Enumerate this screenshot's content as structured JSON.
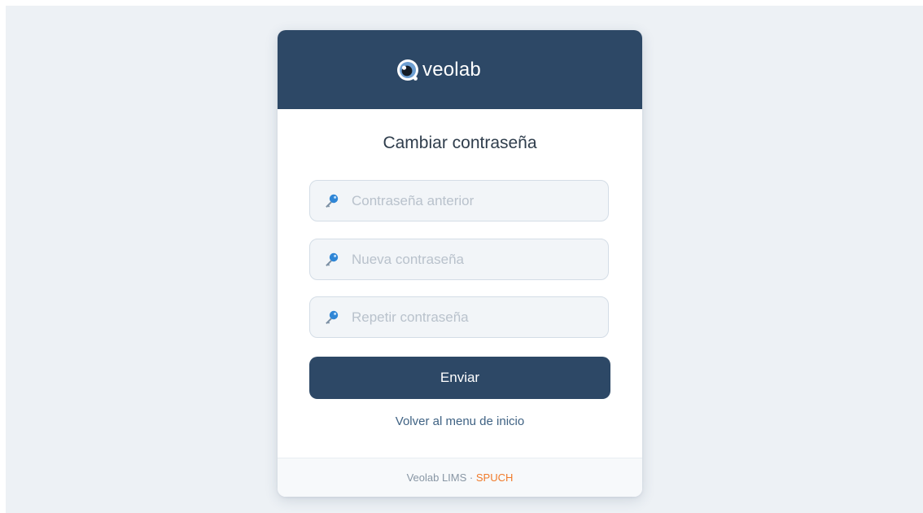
{
  "brand": {
    "name": "veolab",
    "icon": "veolab-logo-icon",
    "header_color": "#2d4866"
  },
  "form": {
    "title": "Cambiar contraseña",
    "fields": [
      {
        "placeholder": "Contraseña anterior",
        "value": "",
        "icon": "key-icon"
      },
      {
        "placeholder": "Nueva contraseña",
        "value": "",
        "icon": "key-icon"
      },
      {
        "placeholder": "Repetir contraseña",
        "value": "",
        "icon": "key-icon"
      }
    ],
    "submit_label": "Enviar",
    "back_link": "Volver al menu de inicio"
  },
  "footer": {
    "product": "Veolab LIMS",
    "separator": "·",
    "org": "SPUCH",
    "org_color": "#f07a2a"
  }
}
